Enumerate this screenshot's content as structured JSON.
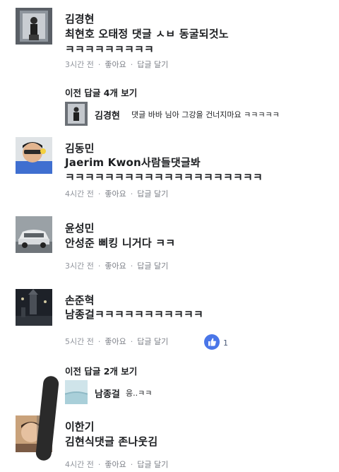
{
  "actions": {
    "like": "좋아요",
    "reply": "답글 달기",
    "sep": "·"
  },
  "comments": [
    {
      "author": "김경현",
      "text": "최현호 오태정  댓글 ㅅㅂ 동굴되것노",
      "text2": "ㅋㅋㅋㅋㅋㅋㅋㅋㅋ",
      "time": "3시간 전"
    },
    {
      "author": "김동민",
      "text": "Jaerim Kwon사람들댓글봐",
      "text2": "ㅋㅋㅋㅋㅋㅋㅋㅋㅋㅋㅋㅋㅋㅋㅋㅋㅋㅋㅋㅋ",
      "time": "4시간 전"
    },
    {
      "author": "윤성민",
      "text": "안성준 삐킹 니거다 ㅋㅋ",
      "time": "3시간 전"
    },
    {
      "author": "손준혁",
      "text": "남종걸ㅋㅋㅋㅋㅋㅋㅋㅋㅋㅋㅋ",
      "time": "5시간 전",
      "reactions": "1"
    },
    {
      "author": "이한기",
      "text": "김현식댓글 존나웃김",
      "time": "4시간 전"
    }
  ],
  "threads": [
    {
      "toggle": "이전 답글 4개 보기",
      "reply_author": "김경현",
      "reply_text": "댓글 바바 님아 그강을 건너지마요 ㅋㅋㅋㅋㅋ"
    },
    {
      "toggle": "이전 답글 2개 보기",
      "reply_author": "남종걸",
      "reply_text": "응..ㅋㅋ"
    }
  ],
  "colors": {
    "meta": "#90949c",
    "like_badge": "#4a76e8",
    "text": "#1c1e21"
  }
}
